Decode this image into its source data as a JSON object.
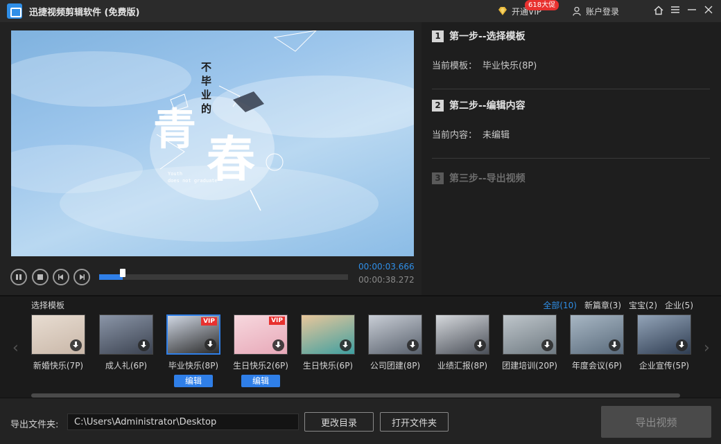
{
  "app": {
    "title": "迅捷视频剪辑软件 (免费版)"
  },
  "header": {
    "vip_label": "开通VIP",
    "vip_badge": "618大促",
    "account_label": "账户登录",
    "icons": [
      "home-icon",
      "menu-icon",
      "minimize-icon",
      "close-icon"
    ]
  },
  "preview": {
    "overlay_cn": [
      "不",
      "毕",
      "业",
      "的",
      "青",
      "春"
    ],
    "overlay_en": "Youth\ndoes not graduate",
    "current_time": "00:00:03.666",
    "total_time": "00:00:38.272",
    "progress_fraction": 0.096
  },
  "steps": {
    "step1": {
      "num": "1",
      "title": "第一步--选择模板",
      "label": "当前模板：",
      "value": "毕业快乐(8P)"
    },
    "step2": {
      "num": "2",
      "title": "第二步--编辑内容",
      "label": "当前内容：",
      "value": "未编辑"
    },
    "step3": {
      "num": "3",
      "title": "第三步--导出视频"
    }
  },
  "templates": {
    "title": "选择模板",
    "filters": [
      "全部(10)",
      "新篇章(3)",
      "宝宝(2)",
      "企业(5)"
    ],
    "active_filter": 0,
    "items": [
      {
        "name": "新婚快乐(7P)",
        "vip": false,
        "edit": false,
        "colors": [
          "#c9b7a8",
          "#e8ddd2"
        ]
      },
      {
        "name": "成人礼(6P)",
        "vip": false,
        "edit": false,
        "colors": [
          "#3b4250",
          "#8b96a8"
        ]
      },
      {
        "name": "毕业快乐(8P)",
        "vip": true,
        "edit": true,
        "colors": [
          "#2b2b2b",
          "#cfd6e2"
        ]
      },
      {
        "name": "生日快乐2(6P)",
        "vip": true,
        "edit": true,
        "colors": [
          "#e7a8b8",
          "#f7d8de"
        ]
      },
      {
        "name": "生日快乐(6P)",
        "vip": false,
        "edit": false,
        "colors": [
          "#3f9fa0",
          "#e9c79b"
        ]
      },
      {
        "name": "公司团建(8P)",
        "vip": false,
        "edit": false,
        "colors": [
          "#58606c",
          "#c9ced6"
        ]
      },
      {
        "name": "业绩汇报(8P)",
        "vip": false,
        "edit": false,
        "colors": [
          "#4a4f58",
          "#d5d8dc"
        ]
      },
      {
        "name": "团建培训(20P)",
        "vip": false,
        "edit": false,
        "colors": [
          "#6f7a82",
          "#bfc6cb"
        ]
      },
      {
        "name": "年度会议(6P)",
        "vip": false,
        "edit": false,
        "colors": [
          "#5a6b7c",
          "#a8b7c4"
        ]
      },
      {
        "name": "企业宣传(5P)",
        "vip": false,
        "edit": false,
        "colors": [
          "#2f3d52",
          "#93a4b8"
        ]
      }
    ],
    "edit_label": "编辑",
    "vip_tag": "VIP"
  },
  "bottom": {
    "output_label": "导出文件夹:",
    "output_path": "C:\\Users\\Administrator\\Desktop",
    "change_dir_label": "更改目录",
    "open_folder_label": "打开文件夹",
    "export_label": "导出视频"
  },
  "colors": {
    "accent": "#2f7fe8",
    "vip": "#e8312f"
  }
}
